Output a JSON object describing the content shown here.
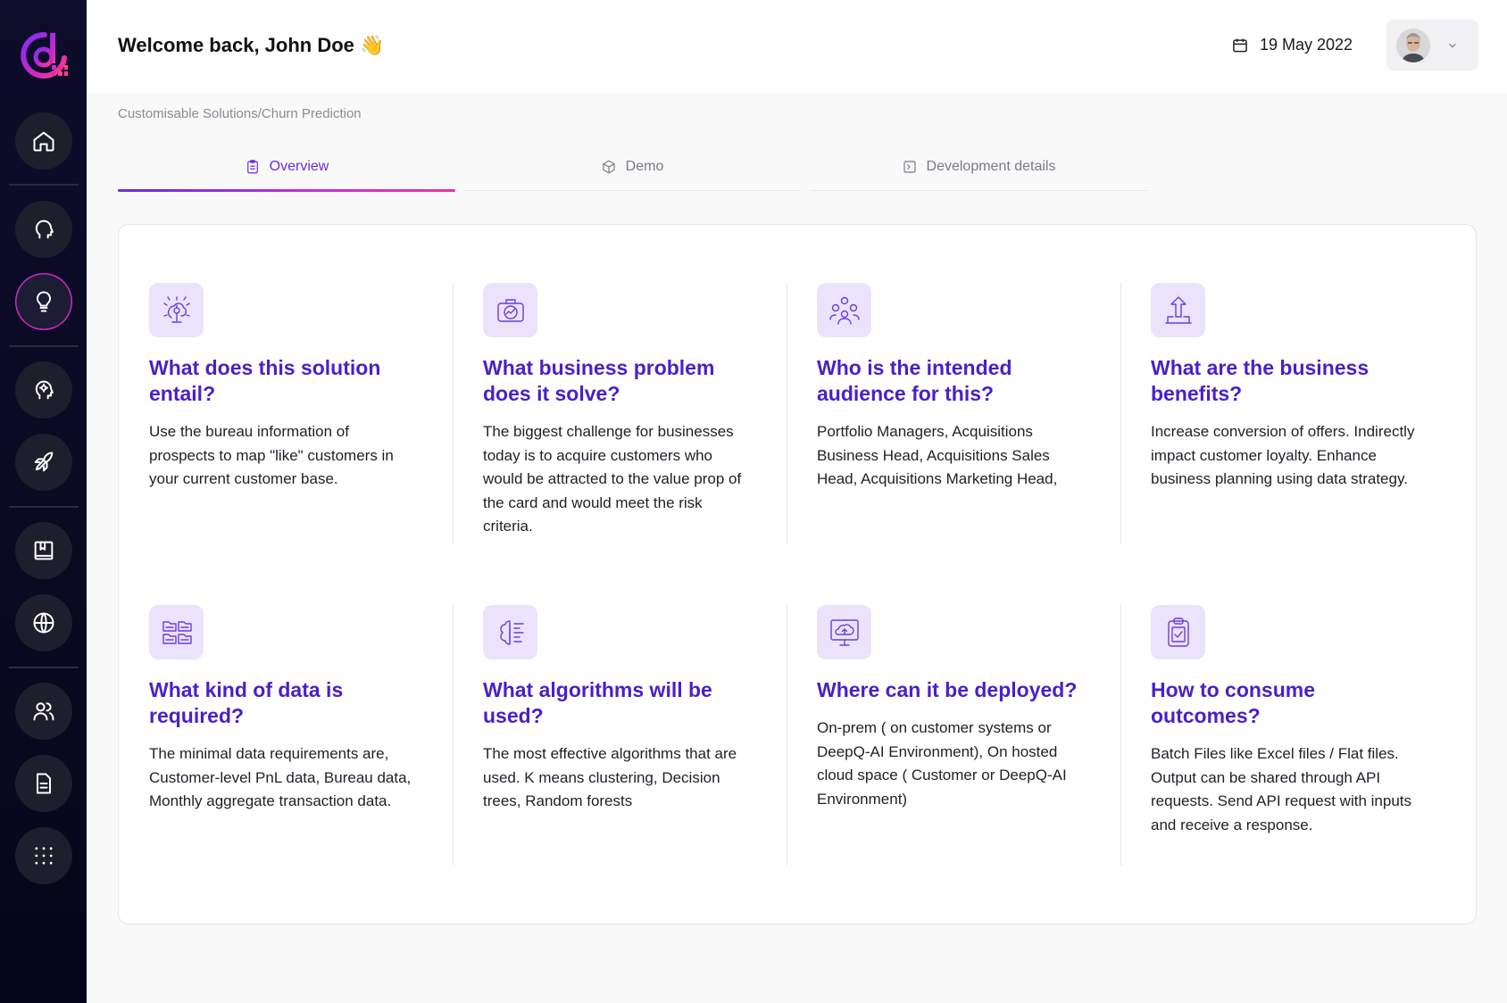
{
  "sidebar": {
    "logo": "deepq-logo",
    "items": [
      {
        "icon": "home-icon",
        "name": "sidebar-item-home"
      },
      {
        "icon": "head-icon",
        "name": "sidebar-item-ai"
      },
      {
        "icon": "lightbulb-icon",
        "name": "sidebar-item-solutions",
        "active": true
      },
      {
        "icon": "head-settings-icon",
        "name": "sidebar-item-customise"
      },
      {
        "icon": "rocket-icon",
        "name": "sidebar-item-deploy"
      },
      {
        "icon": "book-icon",
        "name": "sidebar-item-library"
      },
      {
        "icon": "globe-icon",
        "name": "sidebar-item-network"
      },
      {
        "icon": "users-icon",
        "name": "sidebar-item-team"
      },
      {
        "icon": "document-icon",
        "name": "sidebar-item-documents"
      },
      {
        "icon": "grid-dots-icon",
        "name": "sidebar-item-apps"
      }
    ],
    "accent": "#d126c6"
  },
  "header": {
    "welcome": "Welcome back, John Doe",
    "wave": "👋",
    "date": "19 May 2022"
  },
  "breadcrumb": "Customisable Solutions/Churn Prediction",
  "tabs": [
    {
      "label": "Overview",
      "icon": "clipboard-icon",
      "active": true
    },
    {
      "label": "Demo",
      "icon": "cube-icon",
      "active": false
    },
    {
      "label": "Development details",
      "icon": "terminal-icon",
      "active": false
    }
  ],
  "cards": [
    {
      "icon": "gear-brain-icon",
      "title": "What does this solution entail?",
      "body": "Use the bureau information of prospects to map \"like\" customers in your current customer base."
    },
    {
      "icon": "briefcase-chart-icon",
      "title": "What business problem does it solve?",
      "body": "The biggest challenge for businesses today is to acquire customers who would be attracted to the value prop of the card and would meet the risk criteria."
    },
    {
      "icon": "audience-icon",
      "title": "Who is the intended audience for this?",
      "body": "Portfolio Managers, Acquisitions Business Head, Acquisitions Sales Head, Acquisitions Marketing Head,"
    },
    {
      "icon": "growth-arrow-icon",
      "title": "What are the business benefits?",
      "body": "Increase conversion of offers. Indirectly impact customer loyalty. Enhance business planning using data strategy."
    },
    {
      "icon": "folders-icon",
      "title": "What kind of data is required?",
      "body": "The minimal data requirements are, Customer-level PnL data, Bureau data, Monthly aggregate transaction data."
    },
    {
      "icon": "brain-algorithm-icon",
      "title": "What algorithms will be used?",
      "body": "The most effective algorithms that are used. K means clustering, Decision trees, Random forests"
    },
    {
      "icon": "monitor-cloud-icon",
      "title": "Where can it be deployed?",
      "body": "On-prem ( on customer systems or DeepQ-AI Environment), On hosted cloud space ( Customer or DeepQ-AI Environment)"
    },
    {
      "icon": "clipboard-check-icon",
      "title": "How to consume outcomes?",
      "body": "Batch Files like Excel files / Flat files. Output can be shared through API requests. Send API request with inputs and receive a response."
    }
  ],
  "colors": {
    "title": "#4b1fc8",
    "icon_bg": "#ebe3fb",
    "tab_active": "#6a2cd8"
  }
}
